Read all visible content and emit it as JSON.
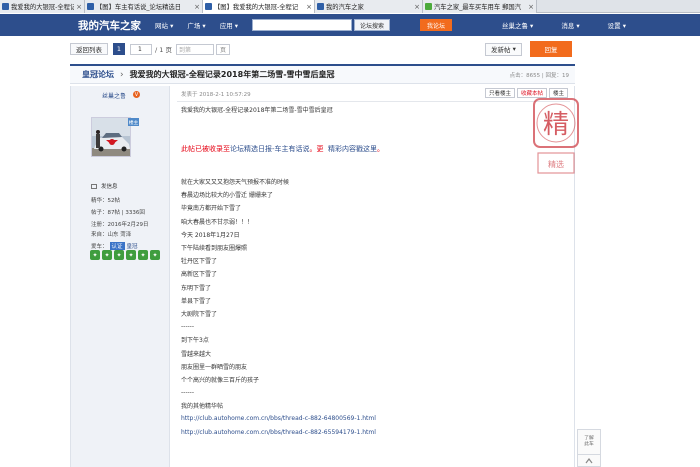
{
  "browser": {
    "tabs": [
      {
        "title": "我爱我的大银冠-全程记",
        "active": false
      },
      {
        "title": "【图】车主有话说_论坛精选日",
        "active": false
      },
      {
        "title": "【图】我爱我的大银冠-全程记",
        "active": true
      },
      {
        "title": "我的汽车之家",
        "active": false
      },
      {
        "title": "汽车之家_最车买车用车 郵国汽",
        "active": false
      }
    ]
  },
  "site_nav": {
    "logo": "我的汽车之家",
    "links": [
      "网站",
      "广场",
      "应用"
    ],
    "search_button": "论坛搜索",
    "post_button": "我论坛",
    "user": "丝巢之鲁",
    "messages": "消息",
    "settings": "设置"
  },
  "toolbar": {
    "back_label": "返回列表",
    "current_page": "1",
    "page_input": "1",
    "page_total": "/ 1 页",
    "goto_label": "到第",
    "goto_unit": "页",
    "new_post": "发新帖",
    "reply": "回复"
  },
  "thread": {
    "forum": "皇冠论坛",
    "title": "我爱我的大银冠-全程记录2018年第二场雪-雪中雪后皇冠",
    "stats": "点击：8655 | 回复：19"
  },
  "author": {
    "name": "丝巢之鲁",
    "badge": "V",
    "owner_tag": "楼主",
    "send_msg": "发信息",
    "essence": "精华：52帖",
    "posts": "帖子：87帖 | 3336回",
    "registered": "注册：2016年2月29日",
    "location": "来自：山东 菏泽",
    "car_label": "爱车：",
    "car_tag": "认证",
    "car_name": "皇冠"
  },
  "post": {
    "time": "发表于 2018-2-1 10:57:29",
    "btn_owner_only": "只看楼主",
    "btn_favorite": "收藏本帖",
    "btn_floor": "楼主",
    "subject": "我爱我的大银冠-全程记录2018年第二场雪-雪中雪后皇冠",
    "notice_prefix": "此帖已被收录至",
    "notice_link": "论坛精选日报-车主有话说",
    "notice_mid": "。更",
    "notice_suffix": "精彩内容戳这里",
    "notice_end": "。",
    "stamp_text": "精",
    "stamp_small": "精选",
    "lines": [
      "就在大家又又又抱怨天气预报不准的时候",
      "春晨边场比较大的小雪迁   姗姗来了",
      "毕竟南方都开始下雪了",
      "咱大春晨也不甘示弱！！！",
      "今天   2018年1月27日",
      "下午陆续看到朋友圈爆照",
      "牡丹区下雪了",
      "高新区下雪了",
      "东明下雪了",
      "单县下雪了",
      "大剧院下雪了",
      "------",
      "到下午3点",
      "雪越来越大",
      "朋友圈里一群晒雪的朋友",
      "个个高兴的就像三百斤的孩子",
      "------",
      "我的其他精华帖",
      "http://club.autohome.com.cn/bbs/thread-c-882-64800569-1.html",
      "http://club.autohome.com.cn/bbs/thread-c-882-65594179-1.html"
    ]
  },
  "side_float": {
    "line1": "了解",
    "line2": "此车"
  }
}
